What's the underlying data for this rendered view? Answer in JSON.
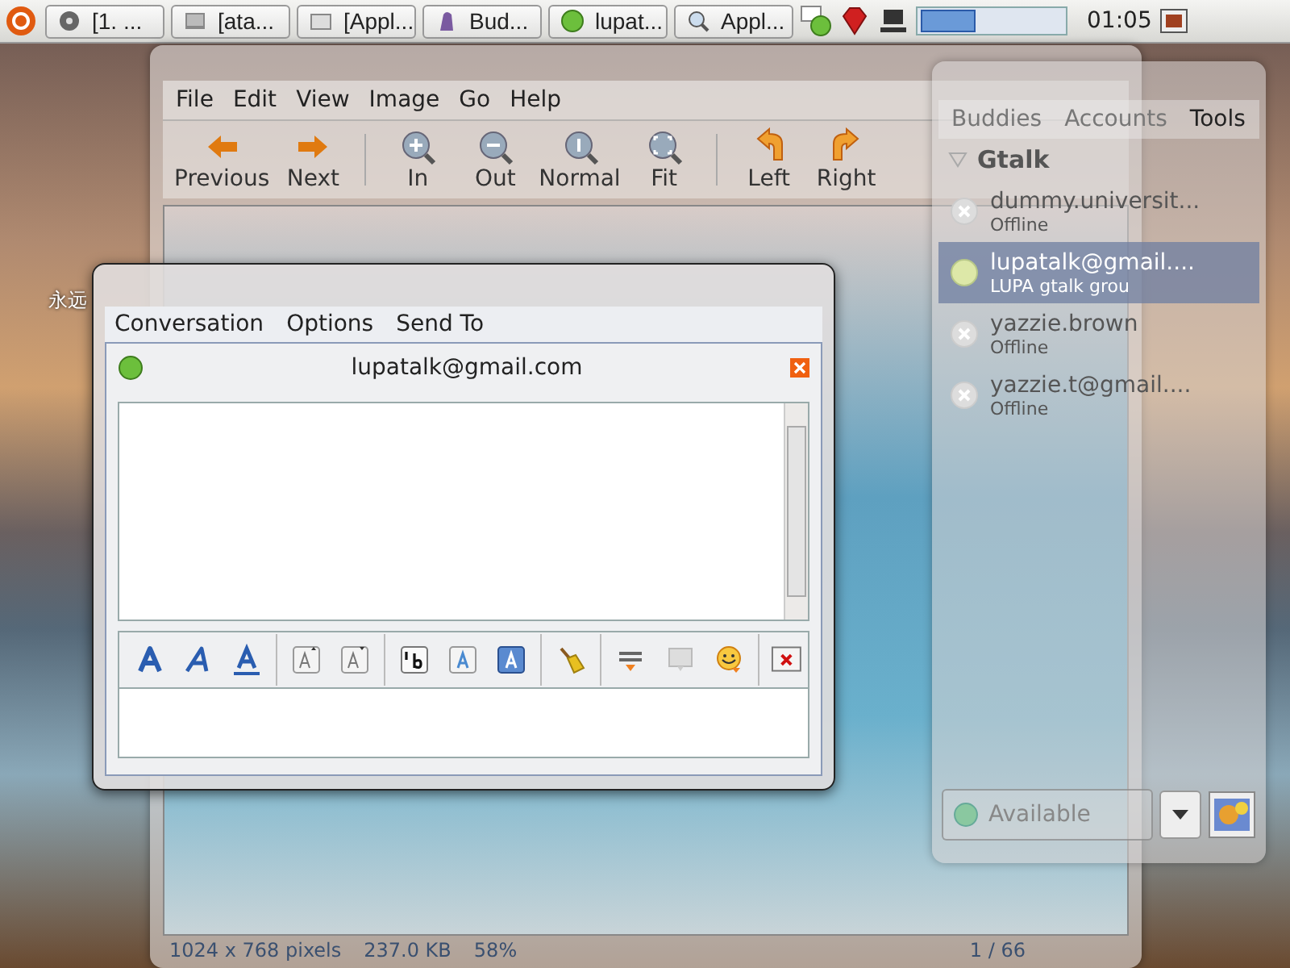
{
  "panel": {
    "tasks": [
      {
        "label": "[1. ..."
      },
      {
        "label": "[ata..."
      },
      {
        "label": "[Appl..."
      },
      {
        "label": "Bud..."
      },
      {
        "label": "lupat..."
      },
      {
        "label": "Appl..."
      }
    ],
    "clock": "01:05"
  },
  "desktop_icon": {
    "label": "永远"
  },
  "viewer": {
    "menu": [
      "File",
      "Edit",
      "View",
      "Image",
      "Go",
      "Help"
    ],
    "toolbar": [
      {
        "label": "Previous"
      },
      {
        "label": "Next"
      },
      {
        "label": "In"
      },
      {
        "label": "Out"
      },
      {
        "label": "Normal"
      },
      {
        "label": "Fit"
      },
      {
        "label": "Left"
      },
      {
        "label": "Right"
      }
    ],
    "status": [
      "1024 x 768 pixels",
      "237.0 KB",
      "58%"
    ],
    "page": "1 / 66"
  },
  "buddy_list": {
    "menu": [
      "Buddies",
      "Accounts",
      "Tools"
    ],
    "group": {
      "name": "Gtalk",
      "expanded": true,
      "buddies": [
        {
          "name": "dummy.universit...",
          "status": "Offline",
          "online": false,
          "selected": false
        },
        {
          "name": "lupatalk@gmail....",
          "status": "LUPA gtalk grou",
          "online": true,
          "selected": true
        },
        {
          "name": "yazzie.brown",
          "status": "Offline",
          "online": false,
          "selected": false
        },
        {
          "name": "yazzie.t@gmail....",
          "status": "Offline",
          "online": false,
          "selected": false
        }
      ]
    },
    "status": "Available"
  },
  "conversation": {
    "menu": [
      "Conversation",
      "Options",
      "Send To"
    ],
    "tab": {
      "title": "lupatalk@gmail.com",
      "online": true
    }
  }
}
